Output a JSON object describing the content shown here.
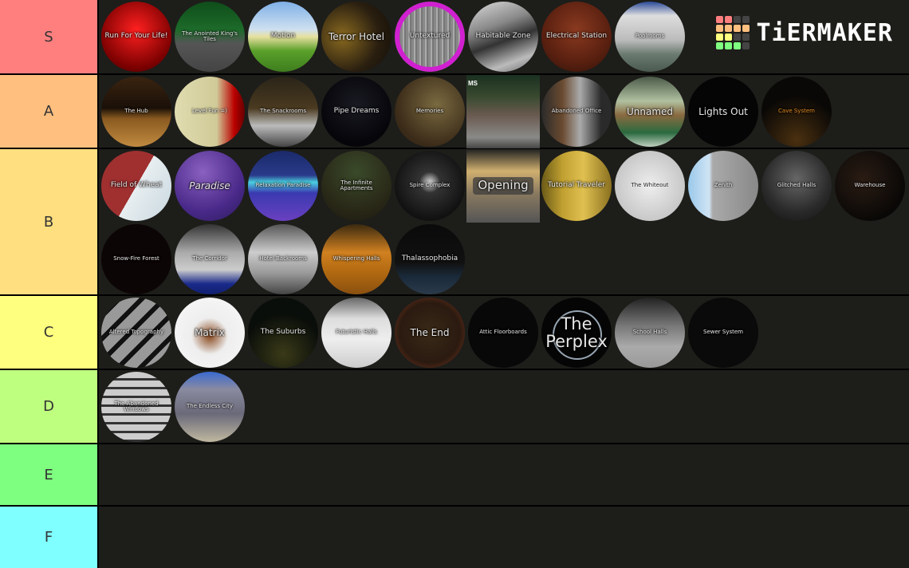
{
  "brand": {
    "name": "TiERMAKER",
    "grid_colors": [
      "#ff7f7f",
      "#ff7f7f",
      "#444444",
      "#444444",
      "#ffbf7f",
      "#ffbf7f",
      "#ffbf7f",
      "#ffbf7f",
      "#ffff7f",
      "#ffff7f",
      "#444444",
      "#444444",
      "#7fff7f",
      "#7fff7f",
      "#7fff7f",
      "#444444"
    ]
  },
  "tiers": [
    {
      "label": "S",
      "color": "#ff7f7f",
      "items": [
        {
          "name": "Run For Your Life!",
          "bg": "radial-gradient(circle at 50% 40%, #ff2020, #7a0000 70%, #300000)",
          "size": "s-md"
        },
        {
          "name": "The Anointed King's Tiles",
          "bg": "linear-gradient(#0f4d1a 0%, #1d6b2a 40%, #555 60%, #444 100%)",
          "size": "s-sm"
        },
        {
          "name": "Motion",
          "bg": "linear-gradient(#7fb0e6 0%, #cfe0f0 40%, #e8e0a0 50%, #5aa02a 70%, #3e7d1e 100%)",
          "size": "s-md"
        },
        {
          "name": "Terror Hotel",
          "bg": "radial-gradient(circle at 30% 50%, #8a6a20, #2a1f10 60%, #120d06)",
          "size": "s-lg"
        },
        {
          "name": "Untextured",
          "bg": "repeating-linear-gradient(90deg,#888 0 3px,#aaa 3px 5px,#777 5px 7px), #c020c0",
          "size": "s-md",
          "border": "#d020d0"
        },
        {
          "name": "Habitable Zone",
          "bg": "linear-gradient(160deg,#ddd 0%, #888 35%, #333 55%, #bbb 80%, #666 100%)",
          "size": "s-md"
        },
        {
          "name": "Electrical Station",
          "bg": "radial-gradient(circle at 50% 40%, #8a3a20, #5a2010 60%, #2a1208)",
          "size": "s-md"
        },
        {
          "name": "Poolrooms",
          "bg": "linear-gradient(#2a4a9a 0%, #ddd 20%, #bbb 55%, #6a7a70 75%, #4a5a50 100%)",
          "size": "s-sm"
        }
      ]
    },
    {
      "label": "A",
      "color": "#ffbf7f",
      "items": [
        {
          "name": "The Hub",
          "bg": "linear-gradient(#3a2410 0%, #1a1008 45%, #8a5a20 60%, #c08a40 100%)",
          "size": "s-sm"
        },
        {
          "name": "Level Fun =)",
          "bg": "linear-gradient(90deg,#e0dcb0 0%, #d0ca98 60%, #b00 85%, #600 100%)",
          "size": "s-sm"
        },
        {
          "name": "The Snackrooms",
          "bg": "linear-gradient(#2a2418 0%, #4a3a20 45%, #bbb 70%, #444 100%)",
          "size": "s-sm"
        },
        {
          "name": "Pipe Dreams",
          "bg": "radial-gradient(circle at 50% 40%, #1a1a22, #05050a 70%)",
          "size": "s-md"
        },
        {
          "name": "Memories",
          "bg": "radial-gradient(circle at 60% 40%, #7a6a40, #3a2a18 70%)",
          "size": "s-sm"
        },
        {
          "name": "",
          "bg": "linear-gradient(#1a3020 0%, #3a4a30 30%, #6a5a50 55%, #8a8a88 85%, #444 100%)",
          "size": "s-sm",
          "square": true,
          "corner": "MS"
        },
        {
          "name": "Abandoned Office",
          "bg": "linear-gradient(90deg,#2a2a2a 0%, #6a4a30 30%, #aaa 55%, #2a2a2a 85%), #334",
          "size": "s-sm"
        },
        {
          "name": "Unnamed",
          "bg": "linear-gradient(#4a5a48 0%, #b0c0a0 35%, #8a6a40 55%, #2a6a40 80%, #c0d0c0 100%)",
          "size": "s-lg"
        },
        {
          "name": "Lights Out",
          "bg": "#050505",
          "size": "s-lg"
        },
        {
          "name": "Cave System",
          "bg": "radial-gradient(circle at 50% 90%, #4a3010, #0a0806 60%)",
          "size": "s-sm",
          "color": "#e08a20"
        }
      ]
    },
    {
      "label": "B",
      "color": "#ffdf7f",
      "items": [
        {
          "name": "Field of Wheat",
          "bg": "linear-gradient(120deg,#a03030 0%, #a03030 50%, #e8eef0 50%, #c8d8e0 100%)",
          "size": "s-md"
        },
        {
          "name": "Paradise",
          "bg": "radial-gradient(circle at 40% 30%, #8a60c0, #4a2a8a 60%, #2a1a5a)",
          "size": "s-lg",
          "italic": true
        },
        {
          "name": "Relaxation Paradise",
          "bg": "linear-gradient(#1a2a6a 0%, #2a3a8a 35%, #4ad0e0 45%, #3a3ab0 60%, #6a40c0 100%)",
          "size": "s-sm"
        },
        {
          "name": "The Infinite Apartments",
          "bg": "radial-gradient(circle at 50% 30%, #3a4a2a, #2a2a18 60%, #1a1810)",
          "size": "s-sm"
        },
        {
          "name": "Spire Complex",
          "bg": "radial-gradient(circle at 50% 45%, #ddd 0%, #333 20%, #111 70%)",
          "size": "s-sm"
        },
        {
          "name": "Opening",
          "bg": "linear-gradient(#222 0%, #d0b070 30%, #8a7a60 60%, #555 100%)",
          "size": "s-xl",
          "square": true
        },
        {
          "name": "Tutorial Traveler",
          "bg": "linear-gradient(90deg,#6a5a18 0%, #c0a030 30%, #e0c050 60%, #8a7020 100%)",
          "size": "s-md"
        },
        {
          "name": "The Whiteout",
          "bg": "radial-gradient(circle at 50% 50%, #eee, #c8c8c8 70%)",
          "size": "s-sm",
          "dark": true
        },
        {
          "name": "Zenith",
          "bg": "linear-gradient(90deg,#9ac8ea 0%, #cfe4f4 30%, #aaa 35%, #888 100%)",
          "size": "s-sm"
        },
        {
          "name": "Glitched Halls",
          "bg": "radial-gradient(circle at 50% 40%, #666, #2a2a2a 60%, #111)",
          "size": "s-sm"
        },
        {
          "name": "Warehouse",
          "bg": "radial-gradient(circle at 40% 40%, #2a1c14, #0a0806 70%)",
          "size": "s-sm"
        },
        {
          "name": "Snow-Fire Forest",
          "bg": "#0c0505",
          "size": "s-sm"
        },
        {
          "name": "The Corridor",
          "bg": "linear-gradient(#333 0%, #aaa 40%, #ccc 65%, #1a2a8a 85%, #102070 100%)",
          "size": "s-sm"
        },
        {
          "name": "Hotel Backrooms",
          "bg": "linear-gradient(#555 0%, #ccc 40%, #999 70%, #444 100%)",
          "size": "s-sm"
        },
        {
          "name": "Whispering Halls",
          "bg": "linear-gradient(#3a2a10 0%, #d08020 40%, #b06810 70%, #8a5010 100%)",
          "size": "s-sm"
        },
        {
          "name": "Thalassophobia",
          "bg": "linear-gradient(#0a0a0a 0%, #111 55%, #1a2a3a 75%, #2a3a4a 100%)",
          "size": "s-md"
        }
      ]
    },
    {
      "label": "C",
      "color": "#ffff7f",
      "items": [
        {
          "name": "Altered Topography",
          "bg": "repeating-linear-gradient(135deg,#999 0 14px,#111 14px 20px)",
          "size": "s-sm"
        },
        {
          "name": "Matrix",
          "bg": "radial-gradient(circle at 50% 55%, #8a4a20 0%, #eee 35%, #f4f4f4 70%)",
          "size": "s-lg"
        },
        {
          "name": "The Suburbs",
          "bg": "radial-gradient(circle at 50% 80%, #3a3a18, #0a0e0a 60%)",
          "size": "s-md"
        },
        {
          "name": "Futuristic Halls",
          "bg": "linear-gradient(#666 0%, #ddd 30%, #eee 60%, #ccc 100%)",
          "size": "s-sm"
        },
        {
          "name": "The End",
          "bg": "radial-gradient(circle at 50% 50%, #3a2a18, #2a1a10 60%, #8a3a20 100%)",
          "size": "s-lg"
        },
        {
          "name": "Attic Floorboards",
          "bg": "#080808",
          "size": "s-sm"
        },
        {
          "name": "The Perplex",
          "bg": "#050505",
          "size": "s-xxl",
          "ring": true
        },
        {
          "name": "School Halls",
          "bg": "linear-gradient(#222 0%, #777 40%, #aaa 70%, #999 100%)",
          "size": "s-sm"
        },
        {
          "name": "Sewer System",
          "bg": "#0a0a0a",
          "size": "s-sm"
        }
      ]
    },
    {
      "label": "D",
      "color": "#bfff7f",
      "items": [
        {
          "name": "The Abandoned Windows",
          "bg": "repeating-linear-gradient(#ccc 0 8px,#333 8px 11px), #bbb",
          "size": "s-sm"
        },
        {
          "name": "The Endless City",
          "bg": "linear-gradient(#3a6ad0 0%, #8a8aa0 25%, #6a6a7a 60%, #c0b8a0 100%)",
          "size": "s-sm"
        }
      ]
    },
    {
      "label": "E",
      "color": "#7fff7f",
      "items": []
    },
    {
      "label": "F",
      "color": "#7fffff",
      "items": []
    }
  ]
}
